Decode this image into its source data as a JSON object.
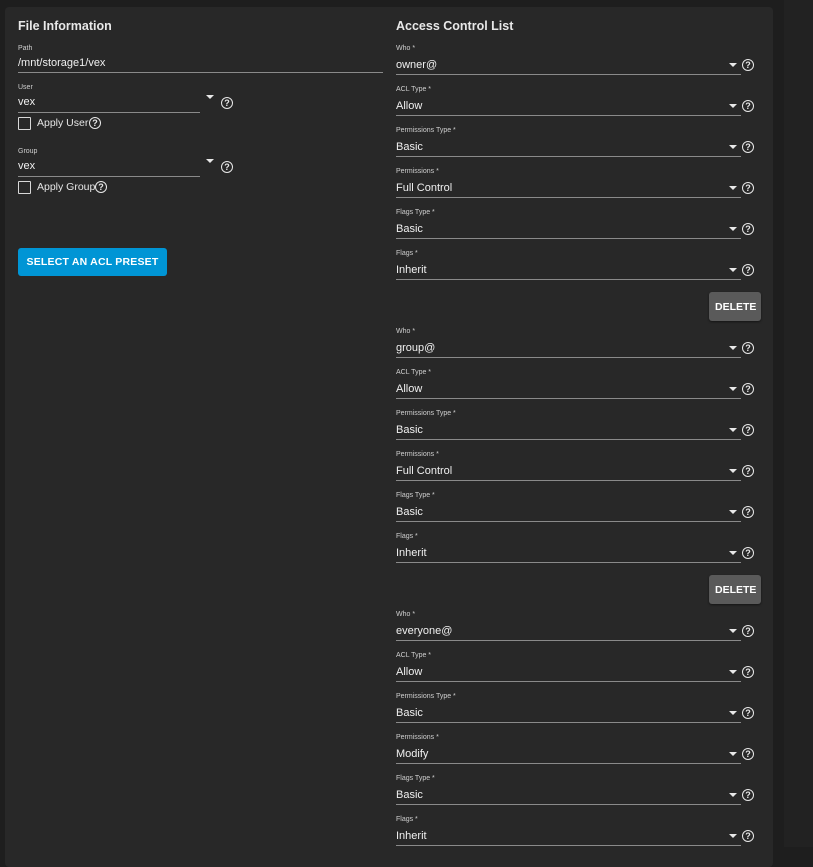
{
  "file_info": {
    "title": "File Information",
    "path": {
      "label": "Path",
      "value": "/mnt/storage1/vex"
    },
    "user": {
      "label": "User",
      "value": "vex",
      "apply_label": "Apply User"
    },
    "group": {
      "label": "Group",
      "value": "vex",
      "apply_label": "Apply Group"
    },
    "preset_button": "SELECT AN ACL PRESET"
  },
  "acl": {
    "title": "Access Control List",
    "delete_label": "DELETE",
    "entries": [
      {
        "who": {
          "label": "Who *",
          "value": "owner@"
        },
        "acl_type": {
          "label": "ACL Type *",
          "value": "Allow"
        },
        "perm_type": {
          "label": "Permissions Type *",
          "value": "Basic"
        },
        "permissions": {
          "label": "Permissions *",
          "value": "Full Control"
        },
        "flags_type": {
          "label": "Flags Type *",
          "value": "Basic"
        },
        "flags": {
          "label": "Flags *",
          "value": "Inherit"
        }
      },
      {
        "who": {
          "label": "Who *",
          "value": "group@"
        },
        "acl_type": {
          "label": "ACL Type *",
          "value": "Allow"
        },
        "perm_type": {
          "label": "Permissions Type *",
          "value": "Basic"
        },
        "permissions": {
          "label": "Permissions *",
          "value": "Full Control"
        },
        "flags_type": {
          "label": "Flags Type *",
          "value": "Basic"
        },
        "flags": {
          "label": "Flags *",
          "value": "Inherit"
        }
      },
      {
        "who": {
          "label": "Who *",
          "value": "everyone@"
        },
        "acl_type": {
          "label": "ACL Type *",
          "value": "Allow"
        },
        "perm_type": {
          "label": "Permissions Type *",
          "value": "Basic"
        },
        "permissions": {
          "label": "Permissions *",
          "value": "Modify"
        },
        "flags_type": {
          "label": "Flags Type *",
          "value": "Basic"
        },
        "flags": {
          "label": "Flags *",
          "value": "Inherit"
        }
      }
    ]
  }
}
